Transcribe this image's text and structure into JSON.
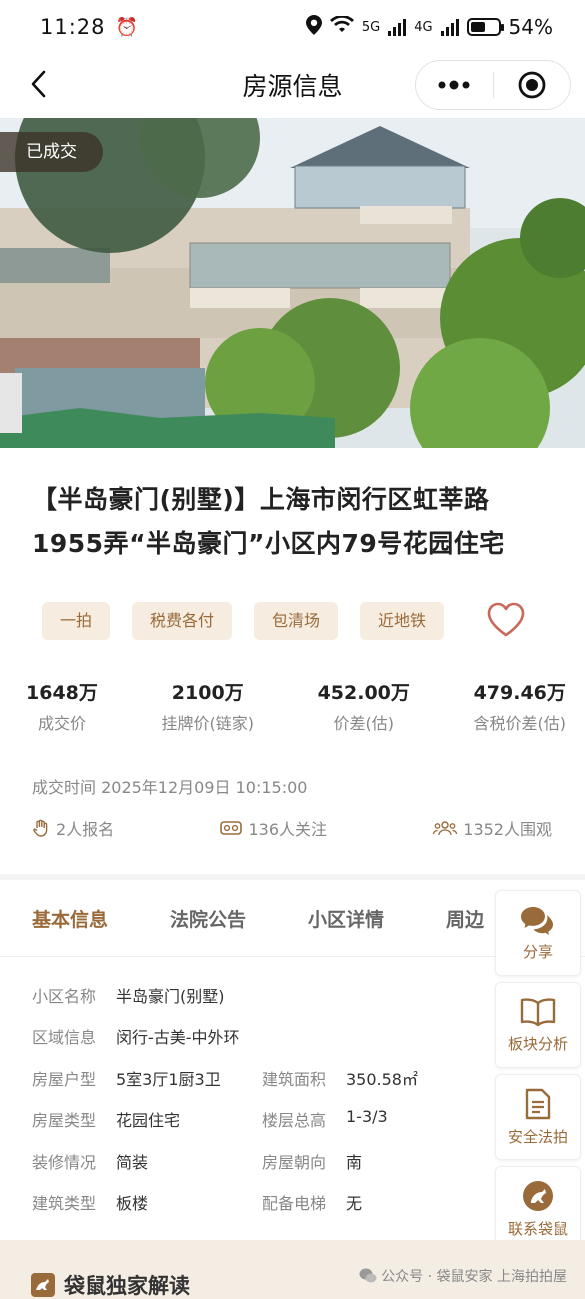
{
  "status_bar": {
    "time": "11:28",
    "battery": "54%",
    "net1": "5G",
    "net2": "4G"
  },
  "nav": {
    "title": "房源信息"
  },
  "hero": {
    "badge": "已成交"
  },
  "listing": {
    "title": "【半岛豪门(别墅)】上海市闵行区虹莘路1955弄“半岛豪门”小区内79号花园住宅",
    "tags": [
      "一拍",
      "税费各付",
      "包清场",
      "近地铁"
    ]
  },
  "stats": [
    {
      "value": "1648万",
      "label": "成交价"
    },
    {
      "value": "2100万",
      "label": "挂牌价(链家)"
    },
    {
      "value": "452.00万",
      "label": "价差(估)"
    },
    {
      "value": "479.46万",
      "label": "含税价差(估)"
    }
  ],
  "deal_time": "成交时间 2025年12月09日 10:15:00",
  "meta": {
    "signups": "2人报名",
    "followers": "136人关注",
    "viewers": "1352人围观"
  },
  "tabs": [
    "基本信息",
    "法院公告",
    "小区详情",
    "周边"
  ],
  "info": {
    "community_key": "小区名称",
    "community_val": "半岛豪门(别墅)",
    "area_key": "区域信息",
    "area_val": "闵行-古美-中外环",
    "layout_key": "房屋户型",
    "layout_val": "5室3厅1厨3卫",
    "size_key": "建筑面积",
    "size_val": "350.58㎡",
    "type_key": "房屋类型",
    "type_val": "花园住宅",
    "floors_key": "楼层总高",
    "floors_val": "1-3/3",
    "deco_key": "装修情况",
    "deco_val": "简装",
    "orient_key": "房屋朝向",
    "orient_val": "南",
    "btype_key": "建筑类型",
    "btype_val": "板楼",
    "elev_key": "配备电梯",
    "elev_val": "无"
  },
  "side": [
    "分享",
    "板块分析",
    "安全法拍",
    "联系袋鼠"
  ],
  "bottom": {
    "title": "袋鼠独家解读",
    "watermark": "公众号 · 袋鼠安家 上海拍拍屋"
  },
  "colors": {
    "accent": "#9a6b3a",
    "tag_bg": "#f6ece0",
    "heart": "#c9695a"
  }
}
